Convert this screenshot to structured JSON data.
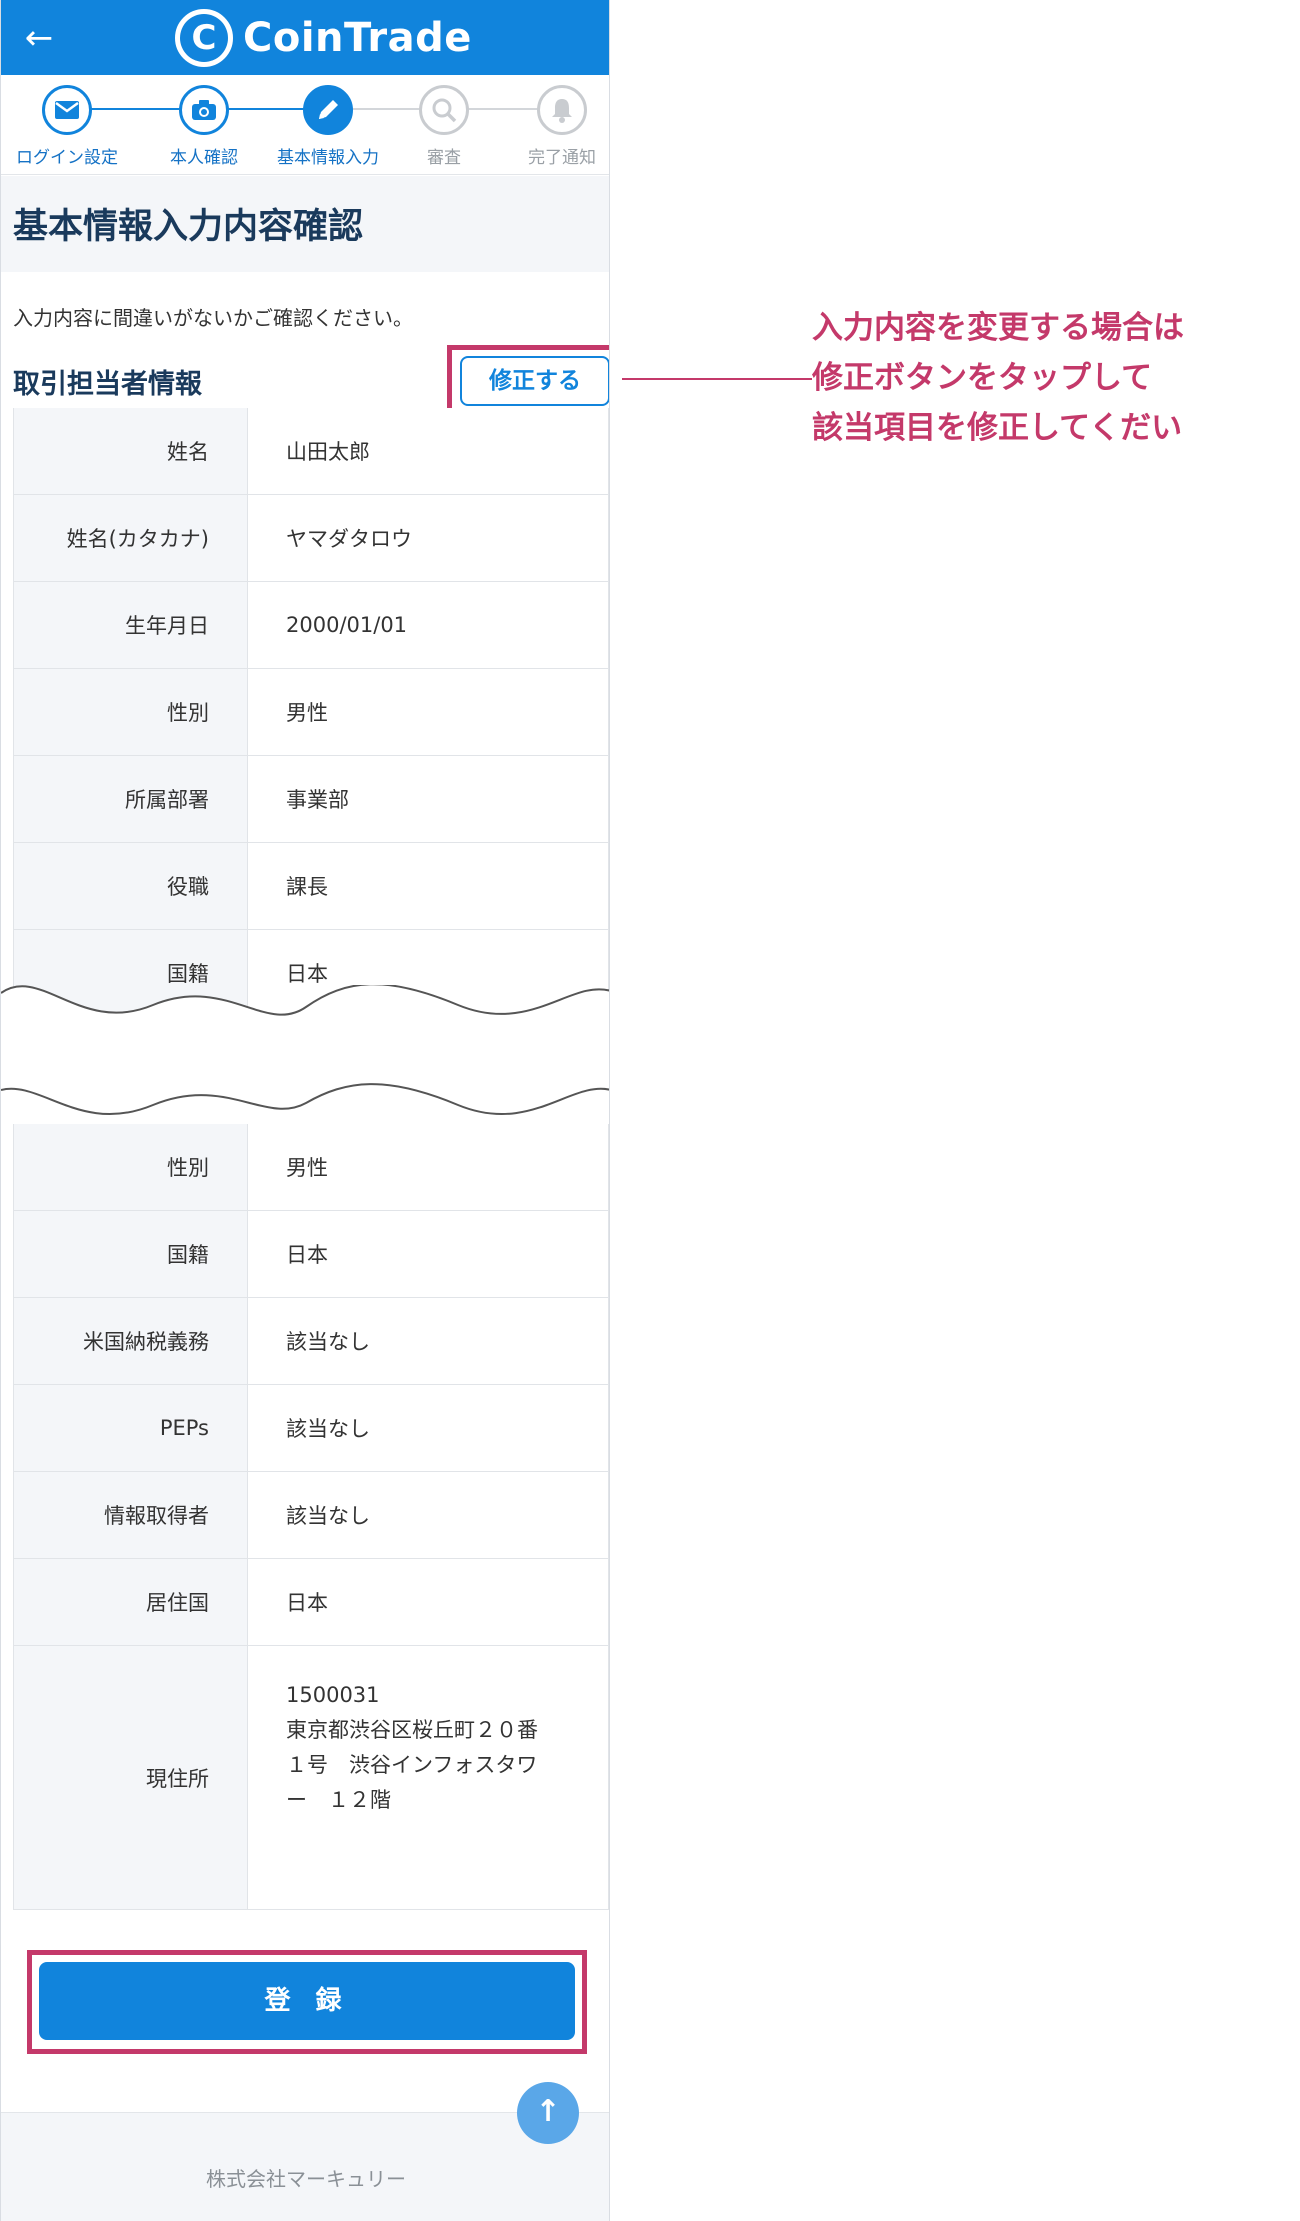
{
  "header": {
    "back_icon": "arrow-left-icon",
    "logo_mark": "C",
    "app_name": "CoinTrade"
  },
  "steps": [
    {
      "label": "ログイン設定",
      "icon": "mail-icon",
      "state": "done"
    },
    {
      "label": "本人確認",
      "icon": "camera-icon",
      "state": "done"
    },
    {
      "label": "基本情報入力",
      "icon": "pencil-icon",
      "state": "active"
    },
    {
      "label": "審査",
      "icon": "magnifier-icon",
      "state": "todo"
    },
    {
      "label": "完了通知",
      "icon": "bell-icon",
      "state": "todo"
    }
  ],
  "page": {
    "title": "基本情報入力内容確認",
    "intro": "入力内容に間違いがないかご確認ください。",
    "section_title": "取引担当者情報",
    "edit_button": "修正する"
  },
  "table_top": [
    {
      "label": "姓名",
      "value": "山田太郎"
    },
    {
      "label": "姓名(カタカナ)",
      "value": "ヤマダタロウ"
    },
    {
      "label": "生年月日",
      "value": "2000/01/01"
    },
    {
      "label": "性別",
      "value": "男性"
    },
    {
      "label": "所属部署",
      "value": "事業部"
    },
    {
      "label": "役職",
      "value": "課長"
    },
    {
      "label": "国籍",
      "value": "日本"
    }
  ],
  "table_bottom": [
    {
      "label": "性別",
      "value": "男性"
    },
    {
      "label": "国籍",
      "value": "日本"
    },
    {
      "label": "米国納税義務",
      "value": "該当なし"
    },
    {
      "label": "PEPs",
      "value": "該当なし"
    },
    {
      "label": "情報取得者",
      "value": "該当なし"
    },
    {
      "label": "居住国",
      "value": "日本"
    }
  ],
  "address": {
    "label": "現住所",
    "value": "1500031\n東京都渋谷区桜丘町２０番\n１号　渋谷インフォスタワ\nー　１２階"
  },
  "register_button": "登 録",
  "footer": "株式会社マーキュリー",
  "annotation": {
    "lines": [
      "入力内容を変更する場合は",
      "修正ボタンをタップして",
      "該当項目を修正してくだい"
    ]
  },
  "colors": {
    "brand": "#1184dc",
    "highlight": "#c4396a"
  }
}
